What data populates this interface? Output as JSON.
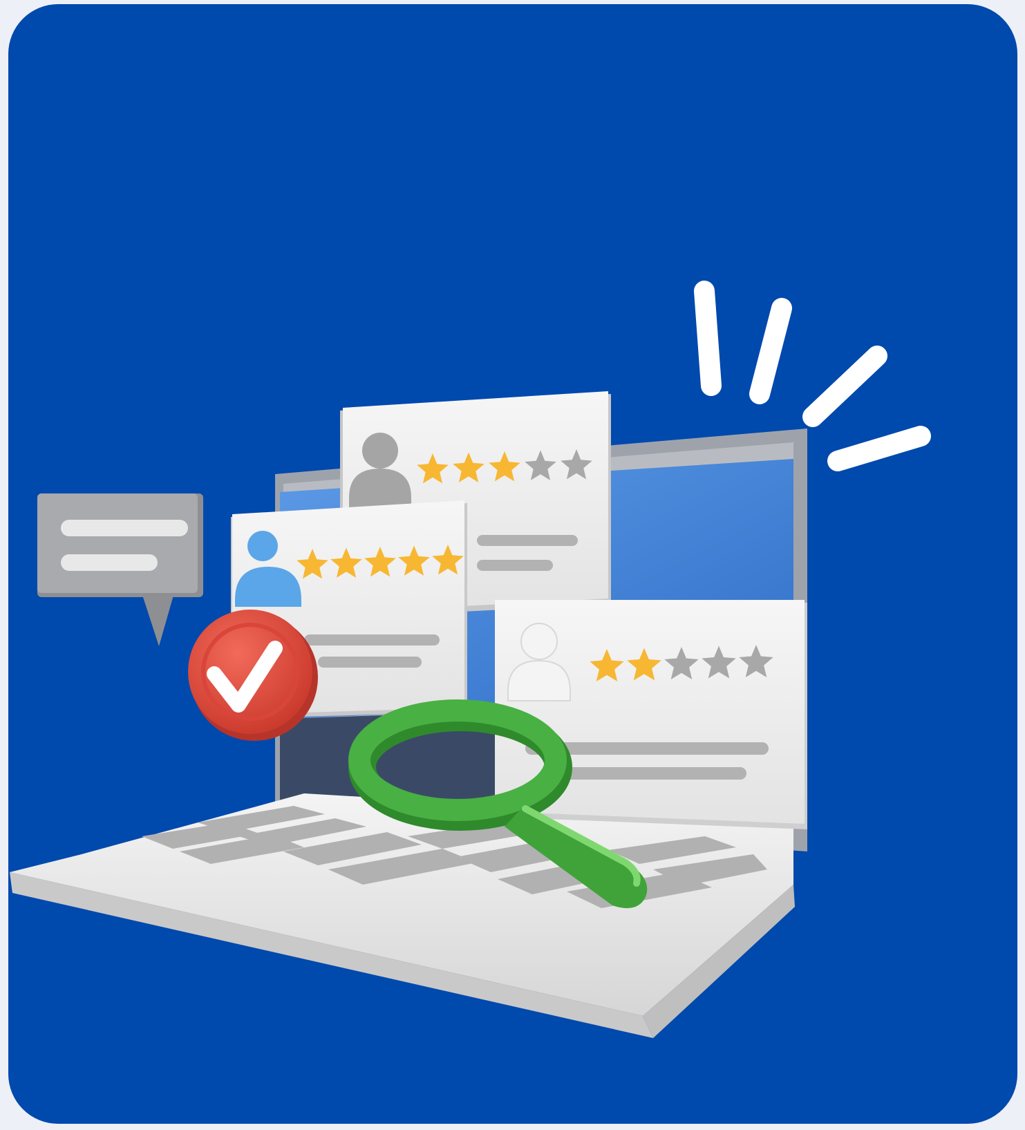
{
  "colors": {
    "background": "#0049ad",
    "page": "#eef0f7",
    "card": "#efefef",
    "star_filled": "#f7b733",
    "star_empty": "#a8a8a8",
    "check_badge": "#e84a3c",
    "magnifier": "#3fa33a",
    "screen": "#4f8ee0"
  },
  "icons": [
    "chat-bubble-icon",
    "check-badge-icon",
    "magnifying-glass-icon",
    "user-avatar-icon",
    "star-icon",
    "sparkle-lines-icon"
  ],
  "reviews": [
    {
      "rating": 3,
      "max": 5,
      "avatar_color": "#a5a5a5"
    },
    {
      "rating": 5,
      "max": 5,
      "avatar_color": "#5aa6e8"
    },
    {
      "rating": 2,
      "max": 5,
      "avatar_color": "#f4f4f4"
    }
  ]
}
